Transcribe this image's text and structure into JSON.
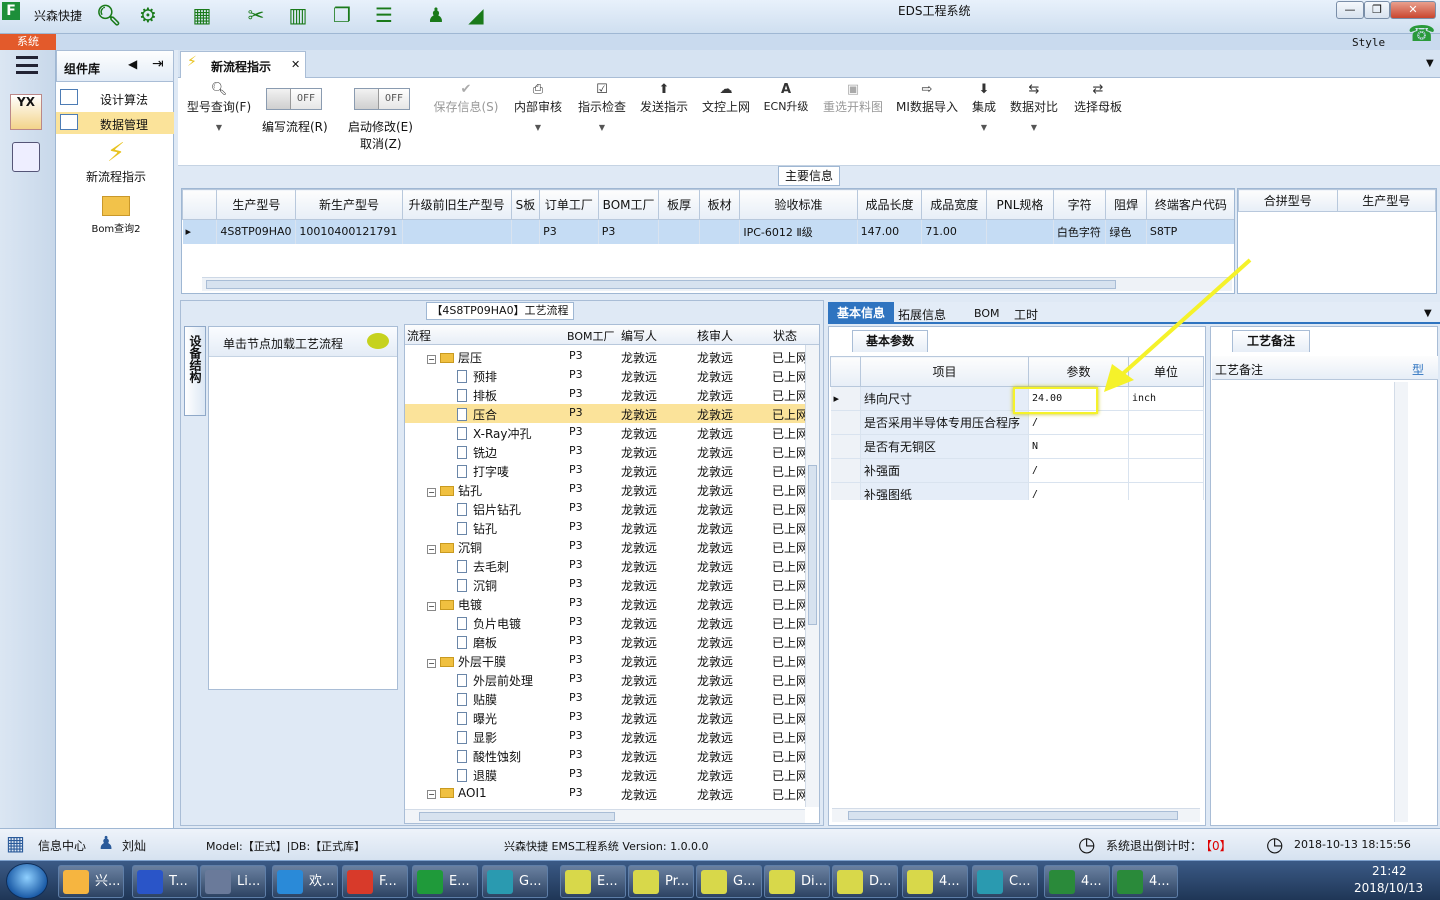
{
  "app": {
    "title": "EDS工程系统",
    "quick_label": "兴森快捷",
    "style_label": "Style",
    "menu_system": "系统"
  },
  "sidebar": {
    "panel_title": "组件库",
    "items": [
      {
        "label": "设计算法"
      },
      {
        "label": "数据管理"
      }
    ],
    "big_items": [
      {
        "label": "新流程指示"
      },
      {
        "label": "Bom查询2"
      }
    ],
    "left_brand": "YX"
  },
  "doc_tab": {
    "label": "新流程指示"
  },
  "toolbar": {
    "buttons": [
      {
        "label": "型号查询(F)"
      },
      {
        "label": "保存信息(S)"
      },
      {
        "label": "内部审核"
      },
      {
        "label": "指示检查"
      },
      {
        "label": "发送指示"
      },
      {
        "label": "文控上网"
      },
      {
        "label": "ECN升级"
      },
      {
        "label": "重选开料图"
      },
      {
        "label": "MI数据导入"
      },
      {
        "label": "集成"
      },
      {
        "label": "数据对比"
      },
      {
        "label": "选择母板"
      }
    ],
    "toggle_write": {
      "label": "编写流程(R)",
      "state": "OFF"
    },
    "toggle_modify": {
      "label": "启动修改(E)",
      "sublabel": "取消(Z)",
      "state": "OFF"
    }
  },
  "main_info": {
    "section_title": "主要信息",
    "columns": [
      "生产型号",
      "新生产型号",
      "升级前旧生产型号",
      "S板",
      "订单工厂",
      "BOM工厂",
      "板厚",
      "板材",
      "验收标准",
      "成品长度",
      "成品宽度",
      "PNL规格",
      "字符",
      "阻焊",
      "终端客户代码"
    ],
    "row": [
      "4S8TP09HA0",
      "10010400121791",
      "",
      "",
      "P3",
      "P3",
      "",
      "",
      "IPC-6012 Ⅱ级",
      "147.00",
      "71.00",
      "",
      "白色字符",
      "绿色",
      "S8TP"
    ],
    "side_columns": [
      "合拼型号",
      "生产型号"
    ]
  },
  "process": {
    "section_title": "【4S8TP09HA0】工艺流程",
    "side_tab": "设备结构",
    "hint": "单击节点加载工艺流程",
    "columns": [
      "流程",
      "BOM工厂",
      "编写人",
      "核审人",
      "状态"
    ],
    "rows": [
      {
        "name": "层压",
        "level": 0,
        "bom": "P3",
        "writer": "龙敦远",
        "reviewer": "龙敦远",
        "status": "已上网"
      },
      {
        "name": "预排",
        "level": 1,
        "bom": "P3",
        "writer": "龙敦远",
        "reviewer": "龙敦远",
        "status": "已上网"
      },
      {
        "name": "排板",
        "level": 1,
        "bom": "P3",
        "writer": "龙敦远",
        "reviewer": "龙敦远",
        "status": "已上网"
      },
      {
        "name": "压合",
        "level": 1,
        "bom": "P3",
        "writer": "龙敦远",
        "reviewer": "龙敦远",
        "status": "已上网",
        "selected": true
      },
      {
        "name": "X-Ray冲孔",
        "level": 1,
        "bom": "P3",
        "writer": "龙敦远",
        "reviewer": "龙敦远",
        "status": "已上网"
      },
      {
        "name": "铣边",
        "level": 1,
        "bom": "P3",
        "writer": "龙敦远",
        "reviewer": "龙敦远",
        "status": "已上网"
      },
      {
        "name": "打字唛",
        "level": 1,
        "bom": "P3",
        "writer": "龙敦远",
        "reviewer": "龙敦远",
        "status": "已上网"
      },
      {
        "name": "钻孔",
        "level": 0,
        "bom": "P3",
        "writer": "龙敦远",
        "reviewer": "龙敦远",
        "status": "已上网"
      },
      {
        "name": "铝片钻孔",
        "level": 1,
        "bom": "P3",
        "writer": "龙敦远",
        "reviewer": "龙敦远",
        "status": "已上网"
      },
      {
        "name": "钻孔",
        "level": 1,
        "bom": "P3",
        "writer": "龙敦远",
        "reviewer": "龙敦远",
        "status": "已上网"
      },
      {
        "name": "沉铜",
        "level": 0,
        "bom": "P3",
        "writer": "龙敦远",
        "reviewer": "龙敦远",
        "status": "已上网"
      },
      {
        "name": "去毛刺",
        "level": 1,
        "bom": "P3",
        "writer": "龙敦远",
        "reviewer": "龙敦远",
        "status": "已上网"
      },
      {
        "name": "沉铜",
        "level": 1,
        "bom": "P3",
        "writer": "龙敦远",
        "reviewer": "龙敦远",
        "status": "已上网"
      },
      {
        "name": "电镀",
        "level": 0,
        "bom": "P3",
        "writer": "龙敦远",
        "reviewer": "龙敦远",
        "status": "已上网"
      },
      {
        "name": "负片电镀",
        "level": 1,
        "bom": "P3",
        "writer": "龙敦远",
        "reviewer": "龙敦远",
        "status": "已上网"
      },
      {
        "name": "磨板",
        "level": 1,
        "bom": "P3",
        "writer": "龙敦远",
        "reviewer": "龙敦远",
        "status": "已上网"
      },
      {
        "name": "外层干膜",
        "level": 0,
        "bom": "P3",
        "writer": "龙敦远",
        "reviewer": "龙敦远",
        "status": "已上网"
      },
      {
        "name": "外层前处理",
        "level": 1,
        "bom": "P3",
        "writer": "龙敦远",
        "reviewer": "龙敦远",
        "status": "已上网"
      },
      {
        "name": "贴膜",
        "level": 1,
        "bom": "P3",
        "writer": "龙敦远",
        "reviewer": "龙敦远",
        "status": "已上网"
      },
      {
        "name": "曝光",
        "level": 1,
        "bom": "P3",
        "writer": "龙敦远",
        "reviewer": "龙敦远",
        "status": "已上网"
      },
      {
        "name": "显影",
        "level": 1,
        "bom": "P3",
        "writer": "龙敦远",
        "reviewer": "龙敦远",
        "status": "已上网"
      },
      {
        "name": "酸性蚀刻",
        "level": 1,
        "bom": "P3",
        "writer": "龙敦远",
        "reviewer": "龙敦远",
        "status": "已上网"
      },
      {
        "name": "退膜",
        "level": 1,
        "bom": "P3",
        "writer": "龙敦远",
        "reviewer": "龙敦远",
        "status": "已上网"
      },
      {
        "name": "AOI1",
        "level": 0,
        "bom": "P3",
        "writer": "龙敦远",
        "reviewer": "龙敦远",
        "status": "已上网"
      }
    ]
  },
  "detail": {
    "tabs": [
      "基本信息",
      "拓展信息",
      "BOM",
      "工时"
    ],
    "subtab": "基本参数",
    "columns": [
      "项目",
      "参数",
      "单位"
    ],
    "rows": [
      {
        "item": "纬向尺寸",
        "param": "24.00",
        "unit": "inch"
      },
      {
        "item": "是否采用半导体专用压合程序",
        "param": "/",
        "unit": ""
      },
      {
        "item": "是否有无铜区",
        "param": "N",
        "unit": ""
      },
      {
        "item": "补强面",
        "param": "/",
        "unit": ""
      },
      {
        "item": "补强图纸",
        "param": "/",
        "unit": ""
      }
    ]
  },
  "remarks": {
    "tab": "工艺备注",
    "column": "工艺备注",
    "column2": "型"
  },
  "status": {
    "center": "信息中心",
    "user": "刘灿",
    "model": "Model:【正式】|DB:【正式库】",
    "version": "兴森快捷 EMS工程系统 Version: 1.0.0.0",
    "countdown_label": "系统退出倒计时：",
    "countdown_value": "【0】",
    "datetime": "2018-10-13 18:15:56"
  },
  "taskbar": {
    "items": [
      "兴...",
      "T...",
      "Li...",
      "欢...",
      "F...",
      "E...",
      "G...",
      "E...",
      "Pr...",
      "G...",
      "Di...",
      "D...",
      "4...",
      "C...",
      "4...",
      "4..."
    ],
    "time": "21:42",
    "date": "2018/10/13"
  },
  "colors": {
    "accent": "#2f74c0",
    "highlight": "#fbe39a",
    "selected_row": "#c5dcf4",
    "arrow": "#f5f22a"
  }
}
